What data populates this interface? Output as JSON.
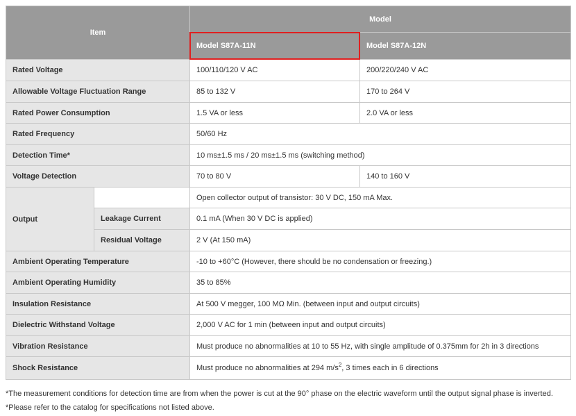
{
  "header": {
    "item": "Item",
    "model": "Model",
    "model_11n": "Model S87A-11N",
    "model_12n": "Model S87A-12N",
    "accent_color": "#e02020"
  },
  "rows": {
    "rated_voltage": {
      "label": "Rated Voltage",
      "v11": "100/110/120 V AC",
      "v12": "200/220/240 V AC"
    },
    "fluctuation": {
      "label": "Allowable Voltage Fluctuation Range",
      "v11": "85 to 132 V",
      "v12": "170 to 264 V"
    },
    "power": {
      "label": "Rated Power Consumption",
      "v11": "1.5 VA or less",
      "v12": "2.0 VA or less"
    },
    "frequency": {
      "label": "Rated Frequency",
      "value": "50/60 Hz"
    },
    "detection_time": {
      "label": "Detection Time*",
      "value": "10 ms±1.5 ms / 20 ms±1.5 ms (switching method)"
    },
    "voltage_detection": {
      "label": "Voltage Detection",
      "v11": "70 to 80 V",
      "v12": "140 to 160 V"
    },
    "output": {
      "label": "Output",
      "main": "Open collector output of transistor: 30 V DC, 150 mA Max.",
      "leakage_label": "Leakage Current",
      "leakage_value": "0.1 mA (When 30 V DC is applied)",
      "residual_label": "Residual Voltage",
      "residual_value": "2 V (At 150 mA)"
    },
    "temperature": {
      "label": "Ambient Operating Temperature",
      "value": "-10 to +60°C (However, there should be no condensation or freezing.)"
    },
    "humidity": {
      "label": "Ambient Operating Humidity",
      "value": "35 to 85%"
    },
    "insulation": {
      "label": "Insulation Resistance",
      "value": "At 500 V megger, 100 MΩ Min. (between input and output circuits)"
    },
    "dielectric": {
      "label": "Dielectric Withstand Voltage",
      "value": "2,000 V AC for 1 min (between input and output circuits)"
    },
    "vibration": {
      "label": "Vibration Resistance",
      "value": "Must produce no abnormalities at 10 to 55 Hz, with single amplitude of 0.375mm for 2h in 3 directions"
    },
    "shock": {
      "label": "Shock Resistance",
      "value_pre": "Must produce no abnormalities at 294 m/s",
      "value_sup": "2",
      "value_post": ", 3 times each in 6 directions"
    }
  },
  "notes": {
    "note1": "*The measurement conditions for detection time are from when the power is cut at the 90° phase on the electric waveform until the output signal phase is inverted.",
    "note2": "*Please refer to the catalog for specifications not listed above."
  }
}
